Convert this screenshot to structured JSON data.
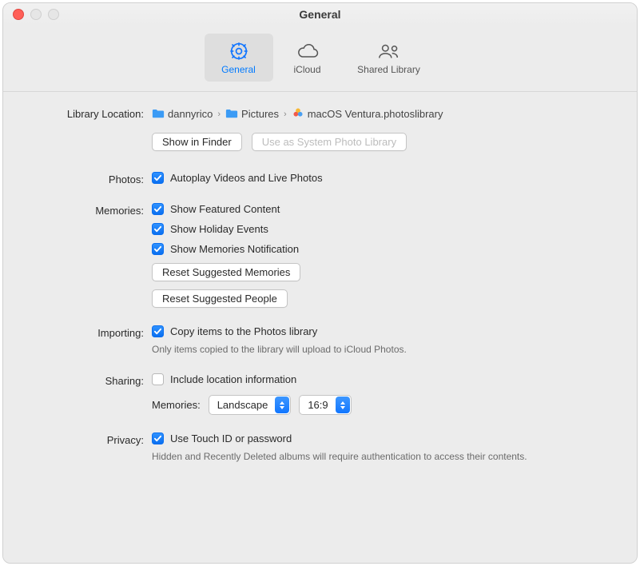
{
  "window": {
    "title": "General"
  },
  "tabs": {
    "general": "General",
    "icloud": "iCloud",
    "shared_library": "Shared Library"
  },
  "library": {
    "label": "Library Location:",
    "path": {
      "seg1": "dannyrico",
      "seg2": "Pictures",
      "seg3": "macOS Ventura.photoslibrary"
    },
    "show_in_finder": "Show in Finder",
    "use_as_system": "Use as System Photo Library"
  },
  "photos": {
    "label": "Photos:",
    "autoplay": "Autoplay Videos and Live Photos"
  },
  "memories": {
    "label": "Memories:",
    "featured": "Show Featured Content",
    "holiday": "Show Holiday Events",
    "notif": "Show Memories Notification",
    "reset_memories": "Reset Suggested Memories",
    "reset_people": "Reset Suggested People"
  },
  "importing": {
    "label": "Importing:",
    "copy": "Copy items to the Photos library",
    "hint": "Only items copied to the library will upload to iCloud Photos."
  },
  "sharing": {
    "label": "Sharing:",
    "include": "Include location information",
    "sub_label": "Memories:",
    "orientation": "Landscape",
    "aspect": "16:9"
  },
  "privacy": {
    "label": "Privacy:",
    "touchid": "Use Touch ID or password",
    "hint": "Hidden and Recently Deleted albums will require authentication to access their contents."
  }
}
